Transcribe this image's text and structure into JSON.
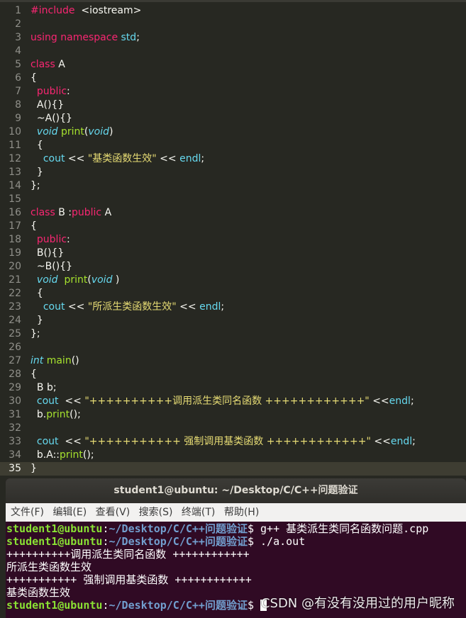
{
  "editor": {
    "current_line": "35",
    "lines": [
      {
        "n": "1",
        "t": "#include  <iostream>"
      },
      {
        "n": "2",
        "t": ""
      },
      {
        "n": "3",
        "t": "using namespace std;"
      },
      {
        "n": "4",
        "t": ""
      },
      {
        "n": "5",
        "t": "class A"
      },
      {
        "n": "6",
        "t": "{"
      },
      {
        "n": "7",
        "t": "  public:"
      },
      {
        "n": "8",
        "t": "  A(){}"
      },
      {
        "n": "9",
        "t": "  ~A(){}"
      },
      {
        "n": "10",
        "t": "  void print(void)"
      },
      {
        "n": "11",
        "t": "  {"
      },
      {
        "n": "12",
        "t": "    cout << \"基类函数生效\" << endl;"
      },
      {
        "n": "13",
        "t": "  }"
      },
      {
        "n": "14",
        "t": "};"
      },
      {
        "n": "15",
        "t": ""
      },
      {
        "n": "16",
        "t": "class B :public A"
      },
      {
        "n": "17",
        "t": "{"
      },
      {
        "n": "18",
        "t": "  public:"
      },
      {
        "n": "19",
        "t": "  B(){}"
      },
      {
        "n": "20",
        "t": "  ~B(){}"
      },
      {
        "n": "21",
        "t": "  void  print(void )"
      },
      {
        "n": "22",
        "t": "  {"
      },
      {
        "n": "23",
        "t": "    cout << \"所派生类函数生效\" << endl;"
      },
      {
        "n": "24",
        "t": "  }"
      },
      {
        "n": "25",
        "t": "};"
      },
      {
        "n": "26",
        "t": ""
      },
      {
        "n": "27",
        "t": "int main()"
      },
      {
        "n": "28",
        "t": "{"
      },
      {
        "n": "29",
        "t": "  B b;"
      },
      {
        "n": "30",
        "t": "  cout  << \"++++++++++调用派生类同名函数 ++++++++++++\" <<endl;"
      },
      {
        "n": "31",
        "t": "  b.print();"
      },
      {
        "n": "32",
        "t": ""
      },
      {
        "n": "33",
        "t": "  cout  << \"+++++++++++ 强制调用基类函数 ++++++++++++\" <<endl;"
      },
      {
        "n": "34",
        "t": "  b.A::print();"
      },
      {
        "n": "35",
        "t": "}"
      }
    ]
  },
  "terminal": {
    "title": "student1@ubuntu: ~/Desktop/C/C++问题验证",
    "menu": [
      "文件(F)",
      "编辑(E)",
      "查看(V)",
      "搜索(S)",
      "终端(T)",
      "帮助(H)"
    ],
    "prompt_user": "student1@ubuntu",
    "prompt_sep": ":",
    "prompt_path": "~/Desktop/C/C++问题验证",
    "cmd1": "$ g++ 基类派生类同名函数问题.cpp",
    "cmd2": "$ ./a.out",
    "out1": "++++++++++调用派生类同名函数 ++++++++++++",
    "out2": "所派生类函数生效",
    "out3": "+++++++++++ 强制调用基类函数 ++++++++++++",
    "out4": "基类函数生效",
    "cmd3": "$ "
  },
  "watermark": "CSDN @有没有没用过的用户昵称",
  "colors": {
    "editor_bg": "#272822",
    "terminal_bg": "#300a24",
    "prompt_user": "#8ae234",
    "prompt_path": "#729fcf"
  }
}
